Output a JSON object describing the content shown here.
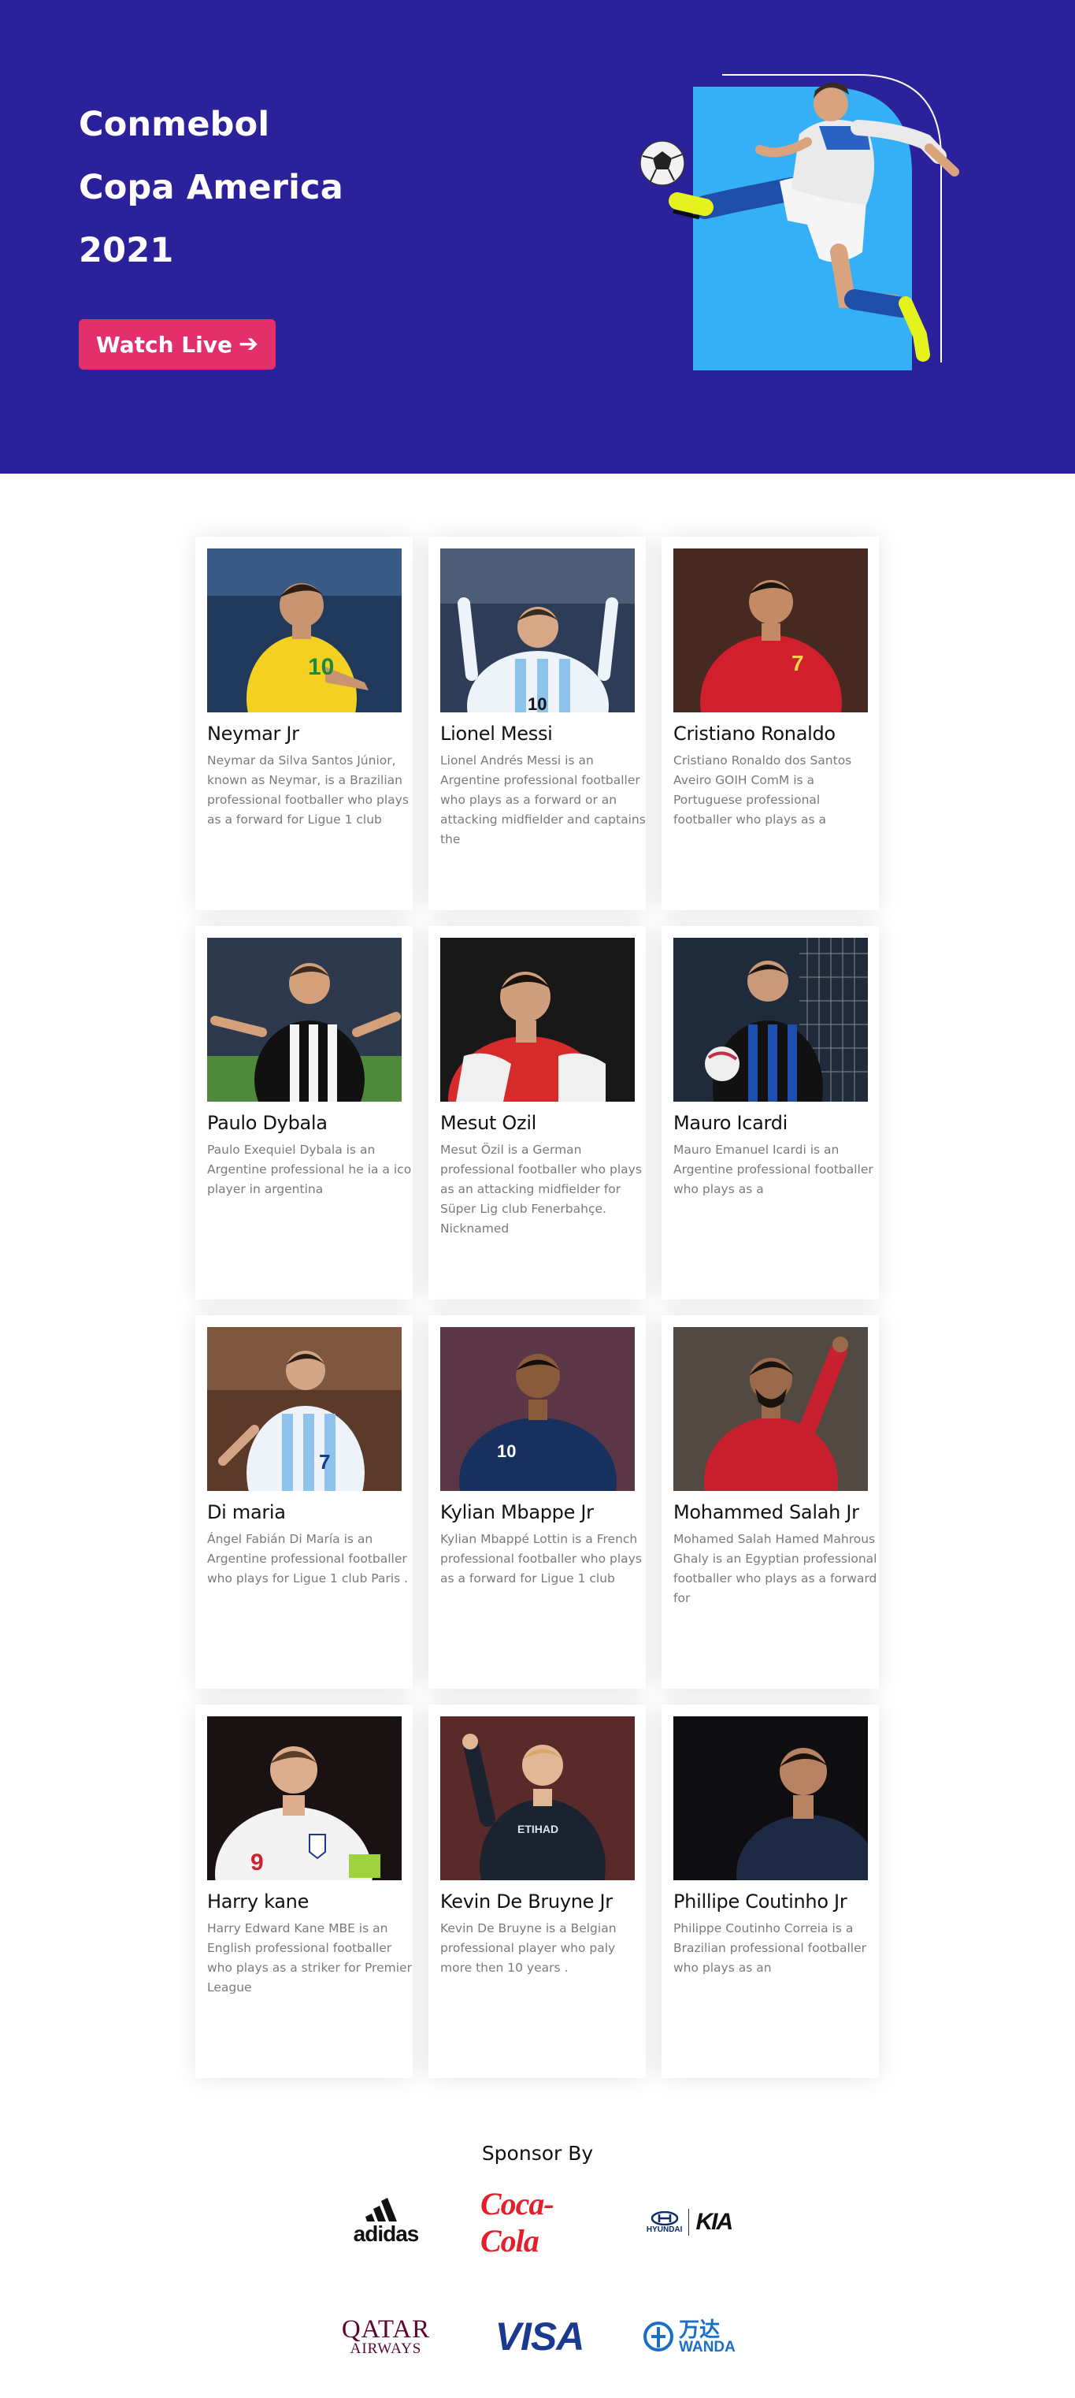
{
  "hero": {
    "title_lines": [
      "Conmebol",
      "Copa America",
      "2021"
    ],
    "watch_button": "Watch Live",
    "accent_color": "#e3306a",
    "background_color": "#2a219b",
    "art_panel_color": "#35b0f7"
  },
  "players": [
    {
      "name": "Neymar Jr",
      "bio": "Neymar da Silva Santos Júnior, known as Neymar, is a Brazilian professional footballer who plays as a forward for Ligue 1 club",
      "photo": "player-photo-yellow-kit"
    },
    {
      "name": "Lionel Messi",
      "bio": "Lionel Andrés Messi is an Argentine professional footballer who plays as a forward or an attacking midfielder and captains the",
      "photo": "player-photo-argentina-kit"
    },
    {
      "name": "Cristiano Ronaldo",
      "bio": "Cristiano Ronaldo dos Santos Aveiro GOIH ComM is a Portuguese professional footballer who plays as a",
      "photo": "player-photo-red-kit"
    },
    {
      "name": "Paulo Dybala",
      "bio": "Paulo Exequiel Dybala is an Argentine professional he ia a ico player in argentina",
      "photo": "player-photo-striped-kit"
    },
    {
      "name": "Mesut Ozil",
      "bio": "Mesut Özil is a German professional footballer who plays as an attacking midfielder for Süper Lig club Fenerbahçe. Nicknamed",
      "photo": "player-photo-red-white-kit"
    },
    {
      "name": "Mauro Icardi",
      "bio": "Mauro Emanuel Icardi is an Argentine professional footballer who plays as a",
      "photo": "player-photo-blue-black-kit"
    },
    {
      "name": "Di maria",
      "bio": "Ángel Fabián Di María is an Argentine professional footballer who plays for Ligue 1 club Paris .",
      "photo": "player-photo-argentina-kit"
    },
    {
      "name": "Kylian Mbappe Jr",
      "bio": "Kylian Mbappé Lottin is a French professional footballer who plays as a forward for Ligue 1 club",
      "photo": "player-photo-navy-kit"
    },
    {
      "name": "Mohammed Salah Jr",
      "bio": "Mohamed Salah Hamed Mahrous Ghaly is an Egyptian professional footballer who plays as a forward for",
      "photo": "player-photo-red-kit"
    },
    {
      "name": "Harry kane",
      "bio": "Harry Edward Kane MBE is an English professional footballer who plays as a striker for Premier League",
      "photo": "player-photo-white-kit"
    },
    {
      "name": "Kevin De Bruyne Jr",
      "bio": "Kevin De Bruyne is a Belgian professional player who paly more then 10 years .",
      "photo": "player-photo-dark-kit"
    },
    {
      "name": "Phillipe Coutinho Jr",
      "bio": "Philippe Coutinho Correia is a Brazilian professional footballer who plays as an",
      "photo": "player-photo-navy-kit"
    }
  ],
  "sponsors": {
    "title": "Sponsor By",
    "adidas": "adidas",
    "cocacola": "Coca-Cola",
    "hyundai": "HYUNDAI",
    "kia": "KIA",
    "qatar_line1": "QATAR",
    "qatar_line2": "AIRWAYS",
    "visa": "VISA",
    "wanda_cn": "万达",
    "wanda_en": "WANDA"
  }
}
